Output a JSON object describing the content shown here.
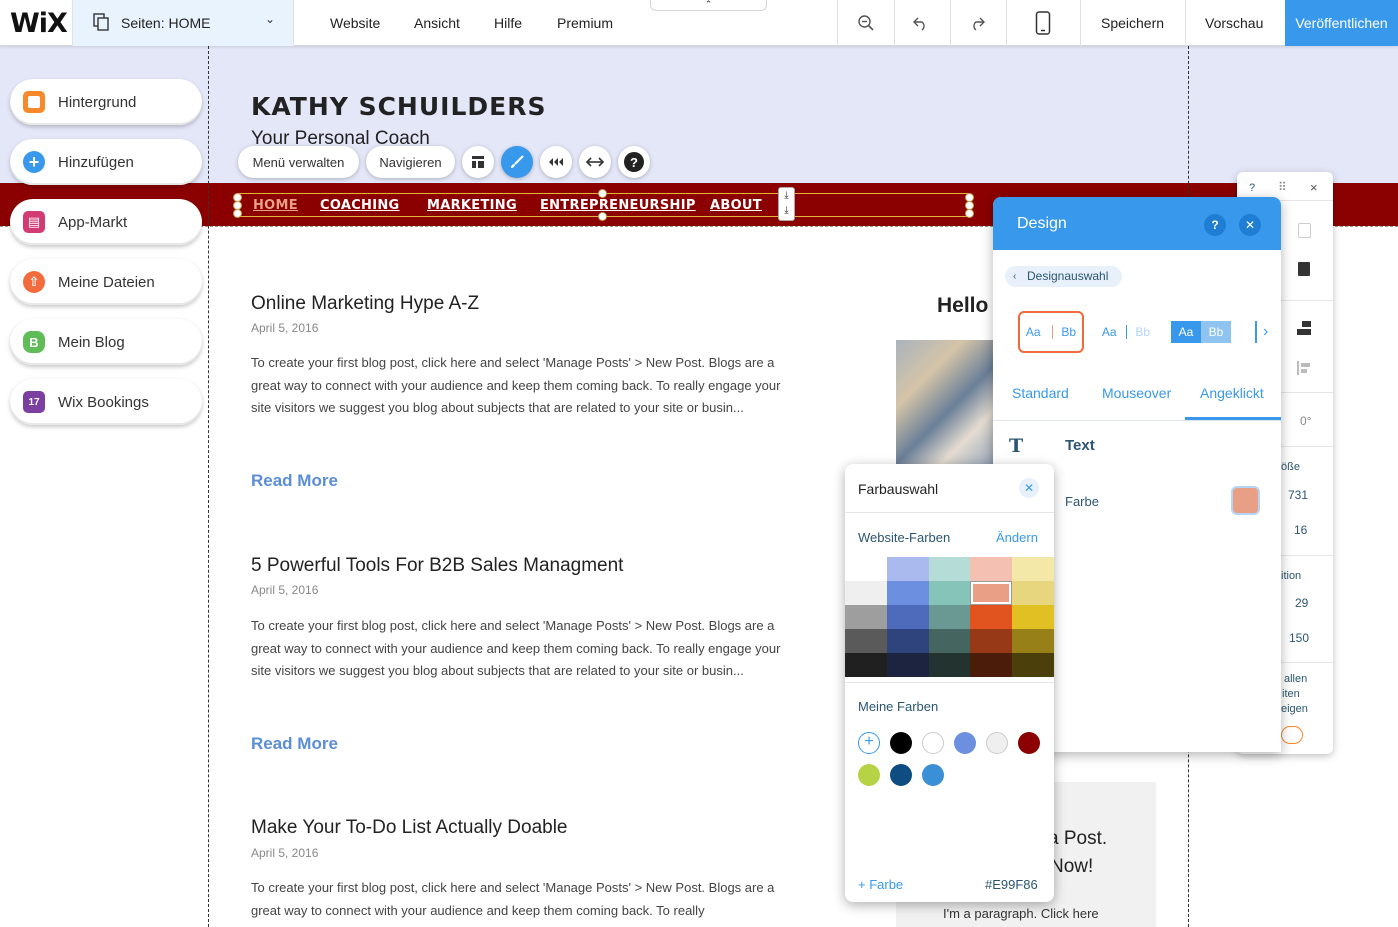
{
  "topbar": {
    "logo": "WiX",
    "pages_label": "Seiten: HOME",
    "menu": [
      "Website",
      "Ansicht",
      "Hilfe",
      "Premium"
    ],
    "save": "Speichern",
    "preview": "Vorschau",
    "publish": "Veröffentlichen",
    "icons": [
      "zoom-out-icon",
      "undo-icon",
      "redo-icon",
      "mobile-icon"
    ]
  },
  "left_panel": {
    "items": [
      {
        "label": "Hintergrund",
        "icon": "background-icon",
        "color": "#f8892b",
        "glyph": ""
      },
      {
        "label": "Hinzufügen",
        "icon": "add-icon",
        "color": "#3899ec",
        "glyph": "+"
      },
      {
        "label": "App-Markt",
        "icon": "app-market-icon",
        "color": "#d23b74",
        "glyph": "▤"
      },
      {
        "label": "Meine Dateien",
        "icon": "upload-icon",
        "color": "#f16b3c",
        "glyph": "⇧"
      },
      {
        "label": "Mein Blog",
        "icon": "blog-icon",
        "color": "#60bc57",
        "glyph": "B"
      },
      {
        "label": "Wix Bookings",
        "icon": "bookings-icon",
        "color": "#7a3fa0",
        "glyph": "17"
      }
    ]
  },
  "site": {
    "title": "KATHY SCHUILDERS",
    "subtitle": "Your Personal Coach",
    "nav": [
      "HOME",
      "COACHING",
      "MARKETING",
      "ENTREPRENEURSHIP",
      "ABOUT"
    ],
    "nav_active_color": "#e99f86",
    "nav_bg": "#8b0000"
  },
  "element_toolbar": {
    "manage_menu": "Menü verwalten",
    "navigate": "Navigieren",
    "icons": [
      "layout-icon",
      "design-brush-icon",
      "animation-icon",
      "stretch-icon",
      "help-icon"
    ]
  },
  "posts": [
    {
      "title": "Online Marketing Hype A-Z",
      "date": "April 5, 2016",
      "body": "To create your first blog post, click here and select 'Manage Posts' > New Post. Blogs are a great way to connect with your audience and keep them coming back. To really engage your site visitors we suggest you blog about subjects that are related to your site or busin...",
      "read_more": "Read More"
    },
    {
      "title": "5 Powerful Tools For B2B Sales Managment",
      "date": "April 5, 2016",
      "body": "To create your first blog post, click here and select 'Manage Posts' > New Post. Blogs are a great way to connect with your audience and keep them coming back. To really engage your site visitors we suggest you blog about subjects that are related to your site or busin...",
      "read_more": "Read More"
    },
    {
      "title": "Make Your To-Do List Actually Doable",
      "date": "April 5, 2016",
      "body": "To create your first blog post, click here and select 'Manage Posts' > New Post. Blogs are a great way to connect with your audience and keep them coming back. To really",
      "read_more": ""
    }
  ],
  "sidebar_content": {
    "hello": "Hello",
    "promo_line1": "a Post.",
    "promo_line2": "Now!",
    "promo_para": "I'm a paragraph. Click here"
  },
  "right_panel": {
    "q": "?",
    "angle": "0°",
    "size_label": "öße",
    "w": "731",
    "h": "16",
    "pos_label": "ition",
    "x": "29",
    "y": "150",
    "show_l1": "allen",
    "show_l2": "iten",
    "show_l3": "eigen"
  },
  "design_panel": {
    "title": "Design",
    "breadcrumb": "Designauswahl",
    "styles": [
      {
        "a": "Aa",
        "b": "Bb"
      },
      {
        "a": "Aa",
        "b": "Bb"
      },
      {
        "a": "Aa",
        "b": "Bb"
      }
    ],
    "tabs": [
      "Standard",
      "Mouseover",
      "Angeklickt"
    ],
    "active_tab": "Angeklickt",
    "section": "Text",
    "color_label": "Farbe",
    "color_value": "#E99F86"
  },
  "color_picker": {
    "title": "Farbauswahl",
    "website_colors": "Website-Farben",
    "change": "Ändern",
    "grid": [
      [
        "#ffffff",
        "#aab9ee",
        "#b5dcd6",
        "#f4c0b1",
        "#f4e8a8"
      ],
      [
        "#efefef",
        "#6c8fe0",
        "#86c4ba",
        "#e99f86",
        "#e7d67d"
      ],
      [
        "#9e9e9e",
        "#4d6bba",
        "#6a9892",
        "#e1541f",
        "#e0c023"
      ],
      [
        "#5a5a5a",
        "#2f437c",
        "#446560",
        "#973816",
        "#968017"
      ],
      [
        "#202020",
        "#1c2440",
        "#223330",
        "#4c1c0b",
        "#4b400c"
      ]
    ],
    "selected": [
      1,
      3
    ],
    "my_colors_label": "Meine Farben",
    "my_colors": [
      "#000000",
      "#ffffff",
      "#6c8fe0",
      "#efefef",
      "#8b0000",
      "#b5d345",
      "#0f4c81",
      "#3a8fd6"
    ],
    "add_color": "+ Farbe",
    "hex": "#E99F86"
  }
}
